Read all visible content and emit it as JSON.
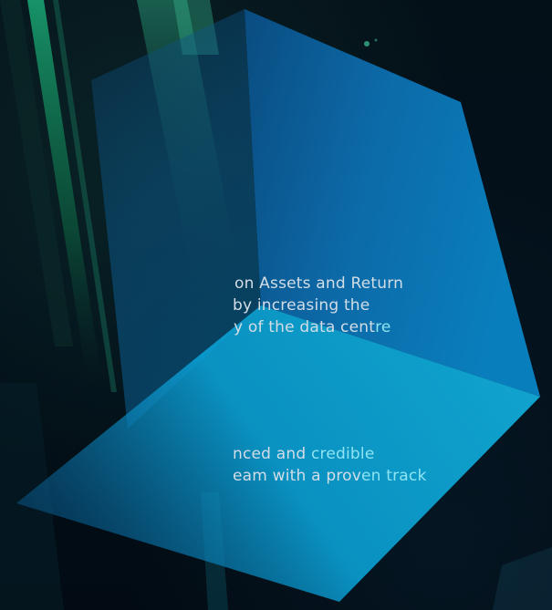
{
  "paragraph_1": {
    "line_1": "on Assets and Return",
    "line_2": "by increasing the",
    "line_3_a": "y of the data cent",
    "line_3_b": "re"
  },
  "paragraph_2": {
    "line_1_a": "nced and ",
    "line_1_b": "credible",
    "line_2_a": "eam with a prov",
    "line_2_b": "en track"
  }
}
